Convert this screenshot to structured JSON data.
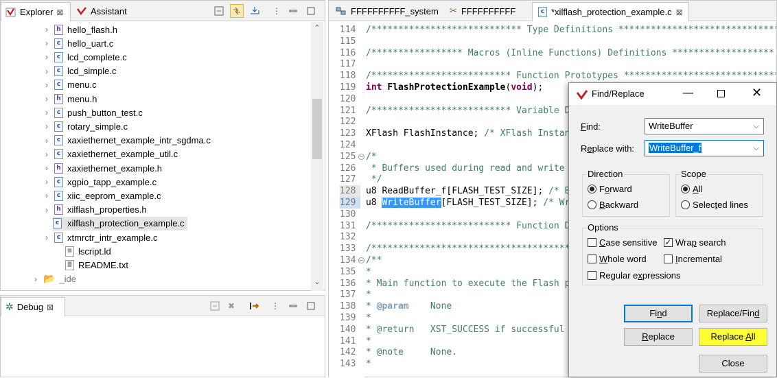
{
  "explorer": {
    "tabs": [
      {
        "label": "Explorer",
        "close": "⊠"
      },
      {
        "label": "Assistant"
      }
    ],
    "items": [
      {
        "label": "hello_flash.h",
        "type": "h"
      },
      {
        "label": "hello_uart.c",
        "type": "c"
      },
      {
        "label": "lcd_complete.c",
        "type": "c"
      },
      {
        "label": "lcd_simple.c",
        "type": "c"
      },
      {
        "label": "menu.c",
        "type": "c"
      },
      {
        "label": "menu.h",
        "type": "h"
      },
      {
        "label": "push_button_test.c",
        "type": "c"
      },
      {
        "label": "rotary_simple.c",
        "type": "c"
      },
      {
        "label": "xaxiethernet_example_intr_sgdma.c",
        "type": "c"
      },
      {
        "label": "xaxiethernet_example_util.c",
        "type": "c"
      },
      {
        "label": "xaxiethernet_example.h",
        "type": "h"
      },
      {
        "label": "xgpio_tapp_example.c",
        "type": "c"
      },
      {
        "label": "xiic_eeprom_example.c",
        "type": "c"
      },
      {
        "label": "xilflash_properties.h",
        "type": "h"
      },
      {
        "label": "xilflash_protection_example.c",
        "type": "c",
        "selected": true
      },
      {
        "label": "xtmrctr_intr_example.c",
        "type": "c"
      },
      {
        "label": "lscript.ld",
        "type": "ld"
      },
      {
        "label": "README.txt",
        "type": "txt"
      }
    ],
    "ide_folder": "_ide"
  },
  "debug": {
    "tab_label": "Debug"
  },
  "editor": {
    "tabs": [
      {
        "label": "FFFFFFFFFF_system"
      },
      {
        "label": "FFFFFFFFFF"
      },
      {
        "label": "*xilflash_protection_example.c",
        "active": true
      }
    ],
    "lines": [
      {
        "n": "114",
        "text": "/**************************** Type Definitions ******************************"
      },
      {
        "n": "115",
        "text": ""
      },
      {
        "n": "116",
        "text": "/***************** Macros (Inline Functions) Definitions *******************"
      },
      {
        "n": "117",
        "text": ""
      },
      {
        "n": "118",
        "text": "/************************** Function Prototypes *****************************"
      },
      {
        "n": "119",
        "kw": "int ",
        "bold": "FlashProtectionExample",
        "rest": "(",
        "kw2": "void",
        "end": ");"
      },
      {
        "n": "120",
        "text": ""
      },
      {
        "n": "121",
        "text": "/************************** Variable D"
      },
      {
        "n": "122",
        "text": ""
      },
      {
        "n": "123",
        "plain": "XFlash FlashInstance; ",
        "text": "/* XFlash Instan"
      },
      {
        "n": "124",
        "text": ""
      },
      {
        "n": "125",
        "text": "/*",
        "fold": true
      },
      {
        "n": "126",
        "text": " * Buffers used during read and write"
      },
      {
        "n": "127",
        "text": " */"
      },
      {
        "n": "128",
        "plain": "u8 ReadBuffer_f[FLASH_TEST_SIZE]; ",
        "text": "/* B"
      },
      {
        "n": "129",
        "pre": "u8 ",
        "hl": "WriteBuffer",
        "post": "[FLASH_TEST_SIZE]; ",
        "text": "/* Wr"
      },
      {
        "n": "130",
        "text": ""
      },
      {
        "n": "131",
        "text": "/************************** Function D"
      },
      {
        "n": "132",
        "text": ""
      },
      {
        "n": "133",
        "text": "/*********************************************"
      },
      {
        "n": "134",
        "text": "/**",
        "fold": true
      },
      {
        "n": "135",
        "text": "*"
      },
      {
        "n": "136",
        "text": "* Main function to execute the Flash p"
      },
      {
        "n": "137",
        "text": "*"
      },
      {
        "n": "138",
        "pre_c": "* ",
        "tag": "@param",
        "text": "    None"
      },
      {
        "n": "139",
        "text": "*"
      },
      {
        "n": "140",
        "text": "* @return   XST_SUCCESS if successful"
      },
      {
        "n": "141",
        "text": "*"
      },
      {
        "n": "142",
        "text": "* @note     None."
      },
      {
        "n": "143",
        "text": "*"
      }
    ]
  },
  "dialog": {
    "title": "Find/Replace",
    "find_label": "Find:",
    "find_value": "WriteBuffer",
    "replace_label": "Replace with:",
    "replace_value": "WriteBuffer_f",
    "direction": {
      "label": "Direction",
      "forward": "Forward",
      "backward": "Backward",
      "selected": "forward"
    },
    "scope": {
      "label": "Scope",
      "all": "All",
      "selected_lines": "Selected lines",
      "selected": "all"
    },
    "options": {
      "label": "Options",
      "case_sensitive": {
        "label": "Case sensitive",
        "checked": false
      },
      "wrap_search": {
        "label": "Wrap search",
        "checked": true
      },
      "whole_word": {
        "label": "Whole word",
        "checked": false
      },
      "incremental": {
        "label": "Incremental",
        "checked": false
      },
      "regex": {
        "label": "Regular expressions",
        "checked": false
      }
    },
    "buttons": {
      "find": "Find",
      "replace_find": "Replace/Find",
      "replace": "Replace",
      "replace_all": "Replace All",
      "close": "Close"
    },
    "colors": {
      "highlight": "#ffff33",
      "accent": "#0078d7"
    }
  }
}
